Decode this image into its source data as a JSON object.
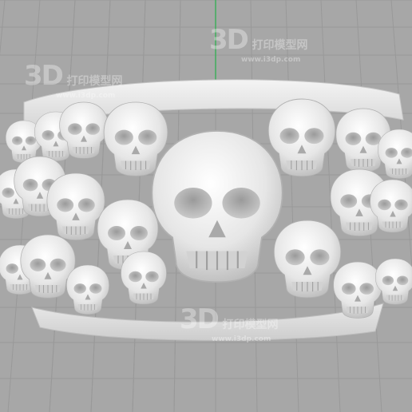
{
  "viewport": {
    "background": "#a7a7a7",
    "grid_color": "#999999",
    "axis_color": "#3fae5a",
    "model_color": "#eeeeee"
  },
  "watermarks": [
    {
      "logo": "3D",
      "cn": "打印模型网",
      "url": "www.i3dp.com"
    },
    {
      "logo": "3D",
      "cn": "打印模型网",
      "url": "www.i3dp.com"
    },
    {
      "logo": "3D",
      "cn": "打印模型网",
      "url": "www.i3dp.com"
    }
  ],
  "model": {
    "name": "skull-ring"
  }
}
